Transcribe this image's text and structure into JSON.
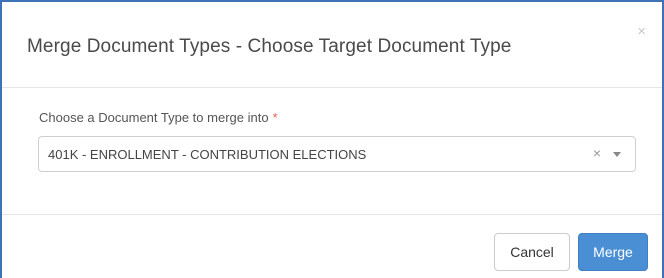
{
  "dialog": {
    "title": "Merge Document Types - Choose Target Document Type",
    "close_label": "×"
  },
  "form": {
    "label": "Choose a Document Type to merge into",
    "required_marker": "*",
    "selected_value": "401K - ENROLLMENT - CONTRIBUTION ELECTIONS",
    "clear_label": "×"
  },
  "footer": {
    "cancel_label": "Cancel",
    "merge_label": "Merge"
  },
  "colors": {
    "accent": "#4a8fd3",
    "required": "#e4604b",
    "frame_border": "#3f73b8"
  }
}
